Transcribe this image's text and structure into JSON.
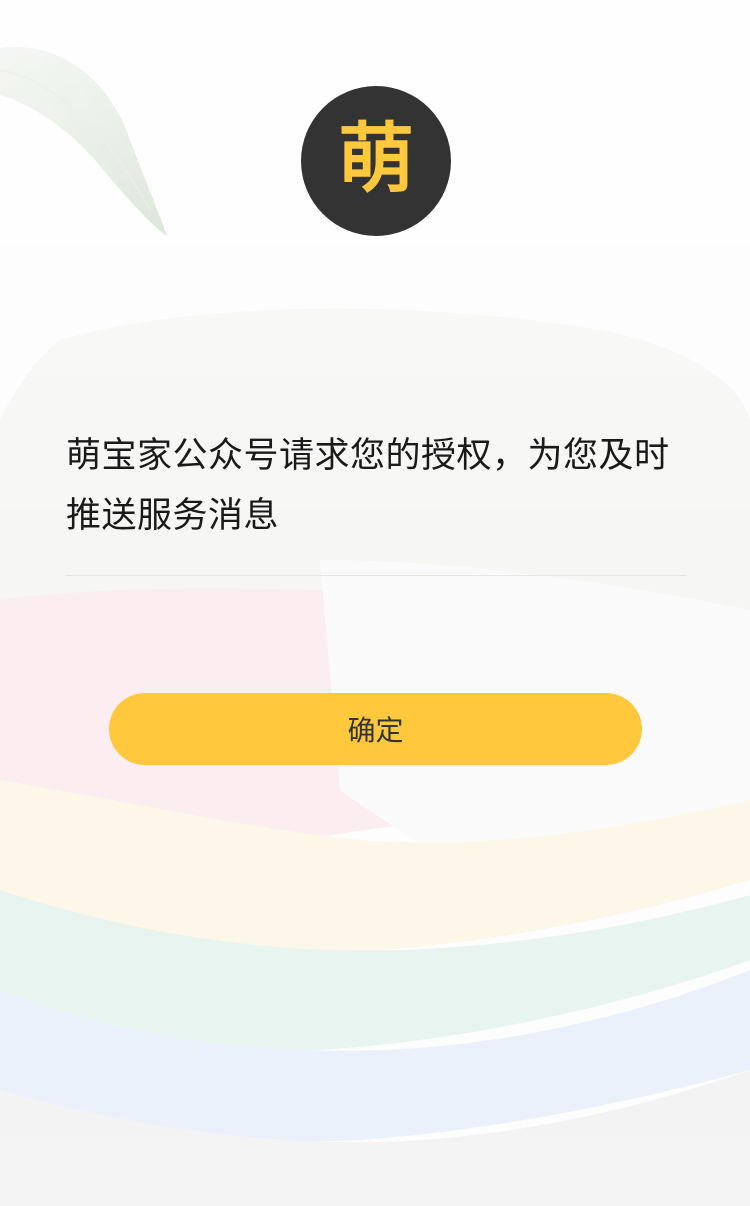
{
  "logo": {
    "glyph": "萌",
    "icon": "brand-logo"
  },
  "message": "萌宝家公众号请求您的授权，为您及时推送服务消息",
  "confirm_button": {
    "label": "确定"
  },
  "colors": {
    "accent": "#ffc83d",
    "logo_background": "#333333",
    "text": "#1a1a1a",
    "divider": "#e6e6e6"
  }
}
